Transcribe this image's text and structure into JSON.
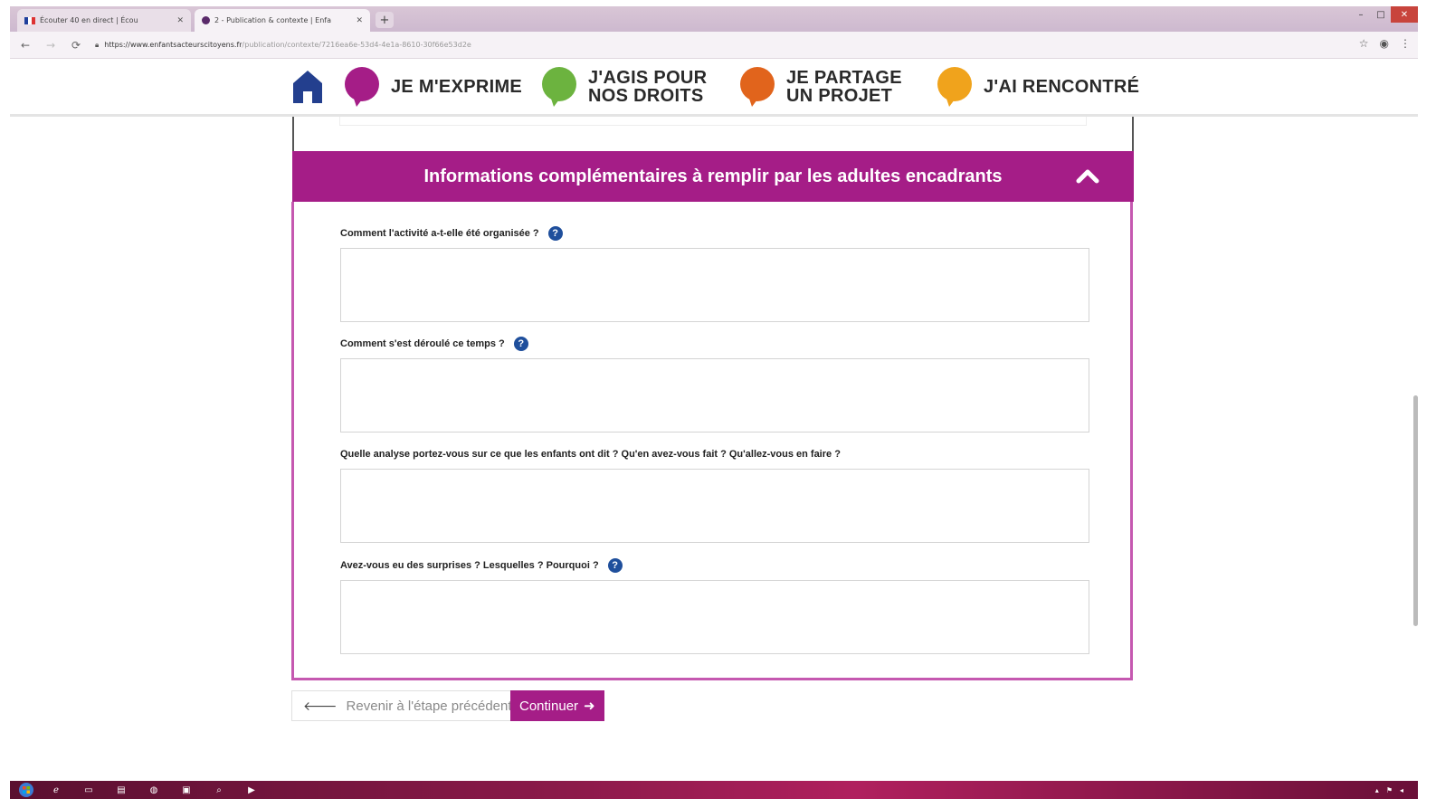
{
  "browser": {
    "tabs": [
      {
        "title": "Écouter 40 en direct | Écou",
        "active": false
      },
      {
        "title": "2 - Publication & contexte | Enfa",
        "active": true
      }
    ],
    "new_tab_label": "+",
    "url_host": "https://www.enfantsacteurscitoyens.fr",
    "url_path": "/publication/contexte/7216ea6e-53d4-4e1a-8610-30f66e53d2e"
  },
  "nav": {
    "items": [
      {
        "label_line1": "JE M'EXPRIME",
        "label_line2": "",
        "color": "#a51d87"
      },
      {
        "label_line1": "J'AGIS POUR",
        "label_line2": "NOS DROITS",
        "color": "#6cb33f"
      },
      {
        "label_line1": "JE PARTAGE",
        "label_line2": "UN PROJET",
        "color": "#e1641c"
      },
      {
        "label_line1": "J'AI RENCONTRÉ",
        "label_line2": "",
        "color": "#f0a31c"
      }
    ]
  },
  "form": {
    "section_title": "Informations complémentaires à remplir par les adultes encadrants",
    "fields": [
      {
        "label": "Comment l'activité a-t-elle été organisée ?",
        "help": "?",
        "value": ""
      },
      {
        "label": "Comment s'est déroulé ce temps ?",
        "help": "?",
        "value": ""
      },
      {
        "label": "Quelle analyse portez-vous sur ce que les enfants ont dit ? Qu'en avez-vous fait ? Qu'allez-vous en faire ?",
        "value": ""
      },
      {
        "label": "Avez-vous eu des surprises ? Lesquelles ? Pourquoi ?",
        "help": "?",
        "value": ""
      }
    ],
    "back_label": "Revenir à l'étape précédente",
    "continue_label": "Continuer"
  },
  "colors": {
    "accent": "#a51d87",
    "help_icon": "#1f4f9c"
  }
}
